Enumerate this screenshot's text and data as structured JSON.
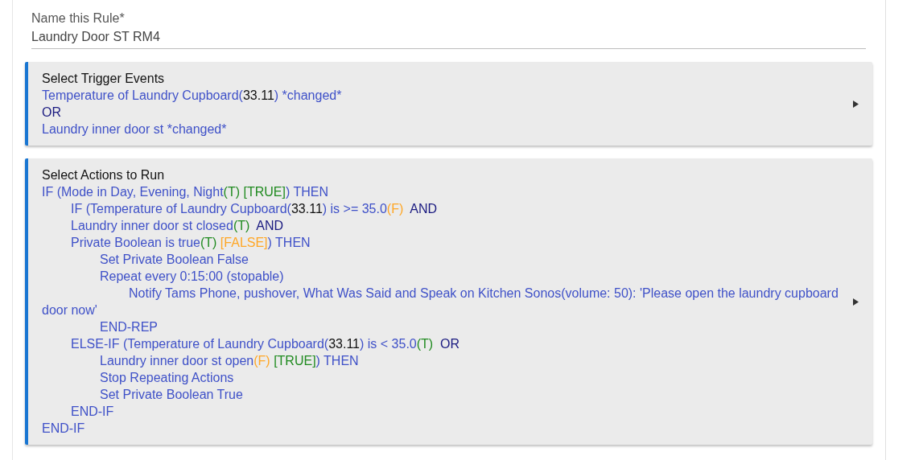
{
  "rule_name": {
    "label": "Name this Rule*",
    "value": "Laundry Door ST RM4"
  },
  "trigger_card": {
    "title": "Select Trigger Events",
    "lines": [
      {
        "segments": [
          {
            "kind": "text",
            "text": "Temperature of Laundry Cupboard("
          },
          {
            "kind": "value",
            "text": "33.11"
          },
          {
            "kind": "text",
            "text": ") *changed*"
          }
        ]
      },
      {
        "segments": [
          {
            "kind": "op",
            "text": "OR"
          }
        ]
      },
      {
        "segments": [
          {
            "kind": "text",
            "text": "Laundry inner door st *changed*"
          }
        ]
      }
    ]
  },
  "actions_card": {
    "title": "Select Actions to Run",
    "lines": [
      {
        "segments": [
          {
            "kind": "text",
            "text": "IF (Mode in Day, Evening, Night"
          },
          {
            "kind": "true",
            "text": "(T)"
          },
          {
            "kind": "true",
            "text": " [TRUE]"
          },
          {
            "kind": "text",
            "text": ") THEN"
          }
        ],
        "children": [
          {
            "segments": [
              {
                "kind": "text",
                "text": "IF (Temperature of Laundry Cupboard("
              },
              {
                "kind": "value",
                "text": "33.11"
              },
              {
                "kind": "text",
                "text": ") is >= 35.0"
              },
              {
                "kind": "false",
                "text": "(F)"
              },
              {
                "kind": "op",
                "text": "  AND"
              }
            ]
          },
          {
            "segments": [
              {
                "kind": "text",
                "text": "Laundry inner door st closed"
              },
              {
                "kind": "true",
                "text": "(T)"
              },
              {
                "kind": "op",
                "text": "  AND"
              }
            ]
          },
          {
            "segments": [
              {
                "kind": "text",
                "text": "Private Boolean is true"
              },
              {
                "kind": "true",
                "text": "(T)"
              },
              {
                "kind": "false",
                "text": " [FALSE]"
              },
              {
                "kind": "text",
                "text": ") THEN"
              }
            ],
            "children": [
              {
                "segments": [
                  {
                    "kind": "text",
                    "text": "Set Private Boolean False"
                  }
                ]
              },
              {
                "segments": [
                  {
                    "kind": "text",
                    "text": "Repeat every 0:15:00 (stopable)"
                  }
                ],
                "children": [
                  {
                    "segments": [
                      {
                        "kind": "text",
                        "text": "Notify Tams Phone, pushover, What Was Said and Speak on Kitchen Sonos(volume: 50): 'Please open the laundry cupboard door now'"
                      }
                    ]
                  }
                ]
              },
              {
                "segments": [
                  {
                    "kind": "text",
                    "text": "END-REP"
                  }
                ]
              }
            ]
          },
          {
            "segments": [
              {
                "kind": "text",
                "text": "ELSE-IF (Temperature of Laundry Cupboard("
              },
              {
                "kind": "value",
                "text": "33.11"
              },
              {
                "kind": "text",
                "text": ") is < 35.0"
              },
              {
                "kind": "true",
                "text": "(T)"
              },
              {
                "kind": "op",
                "text": "  OR"
              }
            ],
            "children": [
              {
                "segments": [
                  {
                    "kind": "text",
                    "text": "Laundry inner door st open"
                  },
                  {
                    "kind": "false",
                    "text": "(F)"
                  },
                  {
                    "kind": "true",
                    "text": " [TRUE]"
                  },
                  {
                    "kind": "text",
                    "text": ") THEN"
                  }
                ]
              },
              {
                "segments": [
                  {
                    "kind": "text",
                    "text": "Stop Repeating Actions"
                  }
                ]
              },
              {
                "segments": [
                  {
                    "kind": "text",
                    "text": "Set Private Boolean True"
                  }
                ]
              }
            ]
          },
          {
            "segments": [
              {
                "kind": "text",
                "text": "END-IF"
              }
            ]
          }
        ]
      },
      {
        "segments": [
          {
            "kind": "text",
            "text": "END-IF"
          }
        ]
      }
    ]
  }
}
